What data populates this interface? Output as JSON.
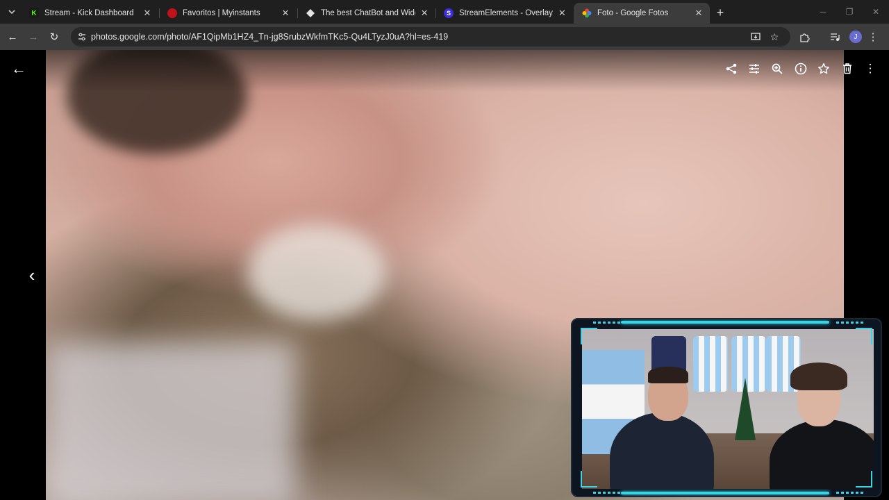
{
  "browser": {
    "tabs": [
      {
        "title": "Stream - Kick Dashboard",
        "icon": "kick-icon",
        "active": false
      },
      {
        "title": "Favoritos | Myinstants",
        "icon": "myinstants-icon",
        "active": false
      },
      {
        "title": "The best ChatBot and Widgets",
        "icon": "streamlabs-icon",
        "active": false
      },
      {
        "title": "StreamElements - Overlays",
        "icon": "streamelements-icon",
        "active": false
      },
      {
        "title": "Foto - Google Fotos",
        "icon": "google-photos-icon",
        "active": true
      }
    ],
    "address": "photos.google.com/photo/AF1QipMb1HZ4_Tn-jg8SrubzWkfmTKc5-Qu4LTyzJ0uA?hl=es-419",
    "profile_initial": "J"
  },
  "viewer": {
    "actions": [
      "share-icon",
      "edit-icon",
      "zoom-icon",
      "info-icon",
      "favorite-icon",
      "delete-icon",
      "more-icon"
    ]
  }
}
